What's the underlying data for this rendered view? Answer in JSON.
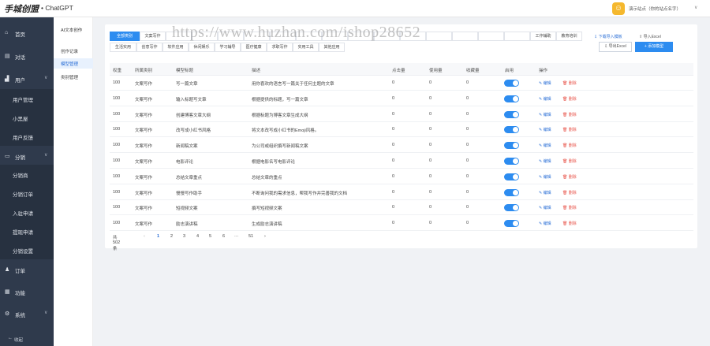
{
  "header": {
    "logo": "手城创盟",
    "app_name": "• ChatGPT",
    "avatar_char": "☺",
    "site_name": "演示站点（你的站点名字）",
    "caret": "∨"
  },
  "sidebar": {
    "items": [
      {
        "icon": "⌂",
        "label": "首页"
      },
      {
        "icon": "▤",
        "label": "对话"
      },
      {
        "icon": "▟",
        "label": "用户",
        "caret": "∨"
      },
      {
        "icon": "▭",
        "label": "分销",
        "caret": "∨"
      },
      {
        "icon": "♟",
        "label": "订单"
      },
      {
        "icon": "▦",
        "label": "功能"
      },
      {
        "icon": "⚙",
        "label": "系统",
        "caret": "∨"
      }
    ],
    "user_sub": [
      "用户管理",
      "小黑屋",
      "用户反馈"
    ],
    "dist_sub": [
      "分销商",
      "分销订单",
      "入驻申请",
      "提现申请",
      "分销设置"
    ],
    "collapse_icon": "←",
    "collapse": "收起"
  },
  "subnav": {
    "title": "AI文本创作",
    "items": [
      "创作记录",
      "模型管理",
      "类别管理"
    ]
  },
  "toolbar": {
    "tabs_row1": [
      "全部类别",
      "文案写作",
      "",
      "",
      "",
      "",
      "",
      "",
      "",
      "",
      "",
      "",
      "",
      "",
      "",
      "",
      "工作辅助",
      "教育培训"
    ],
    "tabs_row2": [
      "生活实用",
      "创意写作",
      "软件应用",
      "休闲娱乐",
      "学习辅导",
      "医疗健康",
      "求职写作",
      "实用工具",
      "其他应用"
    ],
    "download_template": "⇩ 下载导入模板",
    "import_excel": "⇪ 导入Excel",
    "export_excel": "⇩ 导出Excel",
    "add_model": "+ 添加模型"
  },
  "table": {
    "columns": [
      "权重",
      "所属类别",
      "模型标题",
      "描述",
      "点击量",
      "使用量",
      "收藏量",
      "启用",
      "操作"
    ],
    "edit_label": "✎ 编辑",
    "delete_label": "🗑 删除",
    "rows": [
      {
        "weight": "100",
        "category": "文案写作",
        "title": "写一篇文章",
        "desc": "用你喜欢的语言写一篇关于任何主题的文章",
        "clicks": "0",
        "uses": "0",
        "favs": "0",
        "enabled": true
      },
      {
        "weight": "100",
        "category": "文案写作",
        "title": "输入标题写文章",
        "desc": "根据提供的标题，写一篇文章",
        "clicks": "0",
        "uses": "0",
        "favs": "0",
        "enabled": true
      },
      {
        "weight": "100",
        "category": "文案写作",
        "title": "创建博客文章大纲",
        "desc": "根据标题为博客文章生成大纲",
        "clicks": "0",
        "uses": "0",
        "favs": "0",
        "enabled": true
      },
      {
        "weight": "100",
        "category": "文案写作",
        "title": "改写成小红书风格",
        "desc": "将文本改写成小红书的Emoji风格。",
        "clicks": "0",
        "uses": "0",
        "favs": "0",
        "enabled": true
      },
      {
        "weight": "100",
        "category": "文案写作",
        "title": "新闻稿文案",
        "desc": "为公司或组织撰写新闻稿文案",
        "clicks": "0",
        "uses": "0",
        "favs": "0",
        "enabled": true
      },
      {
        "weight": "100",
        "category": "文案写作",
        "title": "电影评论",
        "desc": "根据电影名写电影评论",
        "clicks": "0",
        "uses": "0",
        "favs": "0",
        "enabled": true
      },
      {
        "weight": "100",
        "category": "文案写作",
        "title": "总结文章重点",
        "desc": "总结文章的重点",
        "clicks": "0",
        "uses": "0",
        "favs": "0",
        "enabled": true
      },
      {
        "weight": "100",
        "category": "文案写作",
        "title": "慢慢写作助手",
        "desc": "不断询问我的需求信息，帮我写作并完善我的文档",
        "clicks": "0",
        "uses": "0",
        "favs": "0",
        "enabled": true
      },
      {
        "weight": "100",
        "category": "文案写作",
        "title": "短视频文案",
        "desc": "撰写短视频文案",
        "clicks": "0",
        "uses": "0",
        "favs": "0",
        "enabled": true
      },
      {
        "weight": "100",
        "category": "文案写作",
        "title": "励志演讲稿",
        "desc": "生成励志演讲稿",
        "clicks": "0",
        "uses": "0",
        "favs": "0",
        "enabled": true
      }
    ]
  },
  "pagination": {
    "total": "共 502 条",
    "prev": "‹",
    "pages": [
      "1",
      "2",
      "3",
      "4",
      "5",
      "6",
      "···",
      "51"
    ],
    "next": "›"
  },
  "watermark": "https://www.huzhan.com/ishop28652"
}
